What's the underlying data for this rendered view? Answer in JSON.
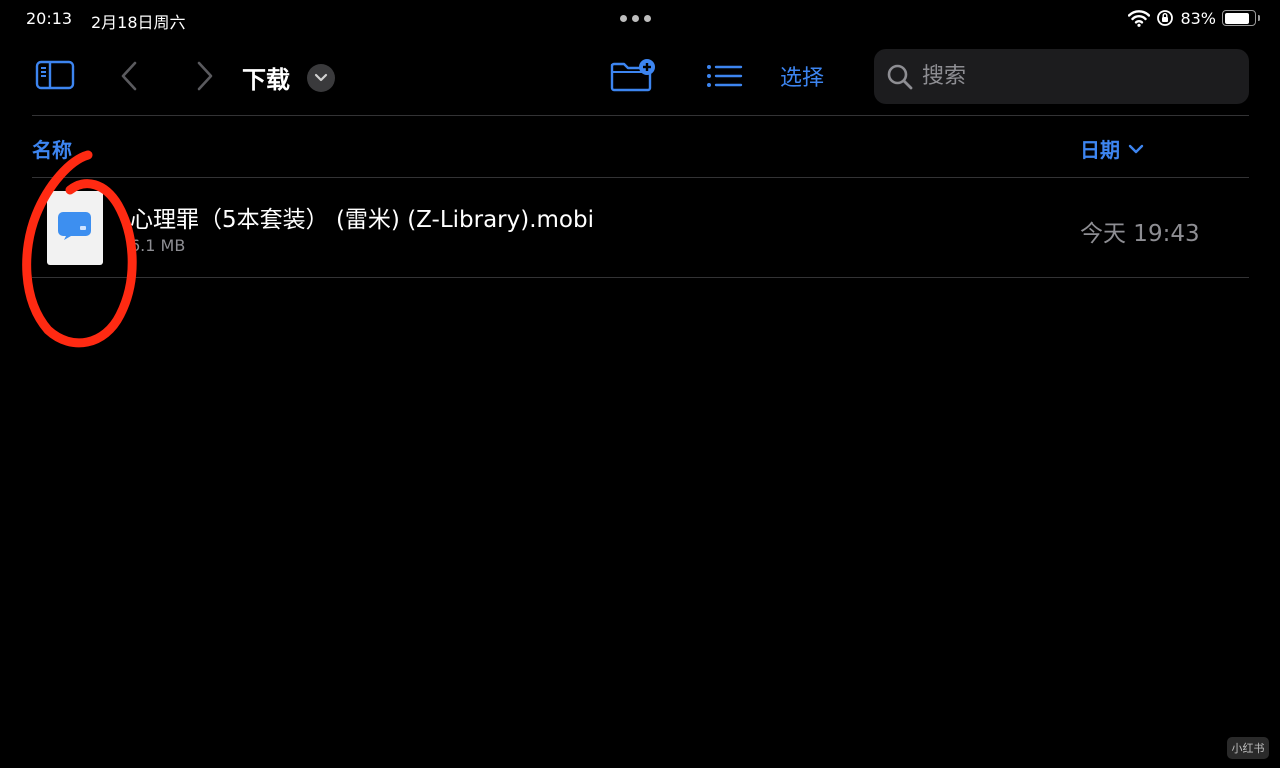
{
  "status_bar": {
    "time": "20:13",
    "date": "2月18日周六",
    "battery_percent": "83%",
    "battery_level": 0.83
  },
  "toolbar": {
    "title": "下载",
    "select_label": "选择",
    "search_placeholder": "搜索",
    "icons": [
      "sidebar-icon",
      "chevron-left-icon",
      "chevron-right-icon",
      "chevron-down-icon",
      "new-folder-icon",
      "list-view-icon",
      "search-icon"
    ]
  },
  "columns": {
    "name_label": "名称",
    "date_label": "日期"
  },
  "files": [
    {
      "name": "心理罪（5本套装） (雷米) (Z-Library).mobi",
      "size": "6.1 MB",
      "date": "今天 19:43",
      "icon": "ebook-file-icon"
    }
  ],
  "annotation": {
    "label": "6",
    "color": "#ff2a12"
  },
  "watermark": "小红书",
  "colors": {
    "background": "#000000",
    "accent": "#3d85f0",
    "secondary_text": "#8e8e93",
    "separator": "#333335",
    "search_field": "#1c1c1e"
  }
}
